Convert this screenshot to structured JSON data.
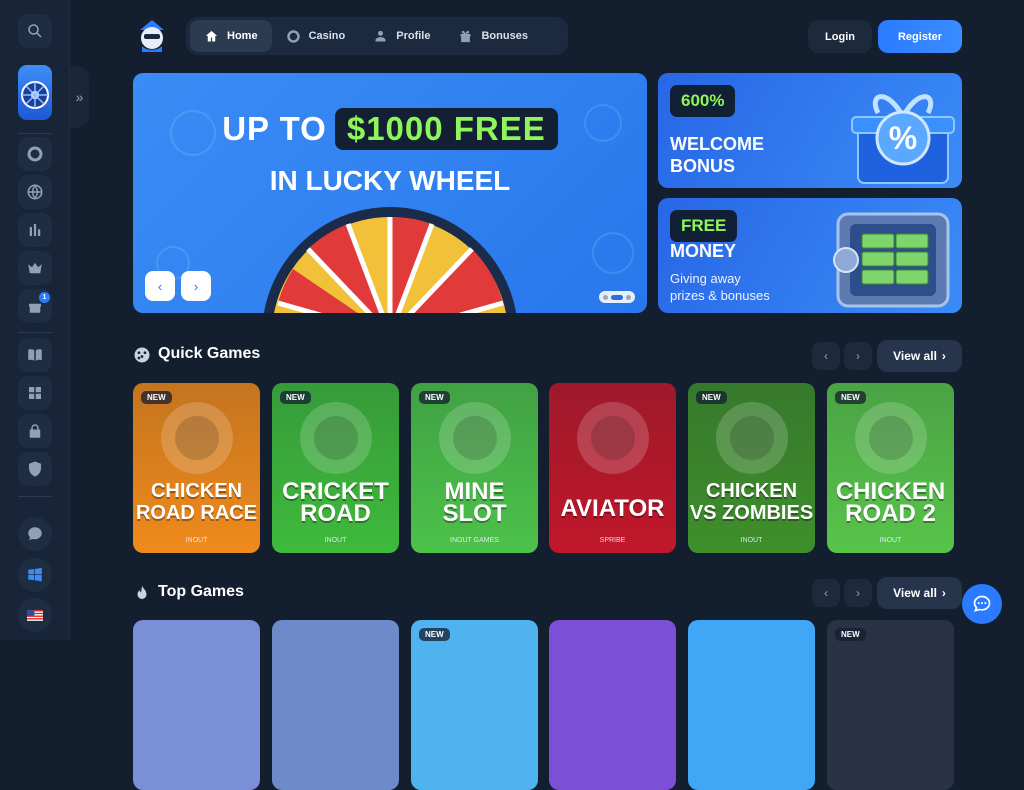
{
  "nav": {
    "items": [
      {
        "label": "Home",
        "icon": "home-icon",
        "active": true
      },
      {
        "label": "Casino",
        "icon": "chip-icon"
      },
      {
        "label": "Profile",
        "icon": "user-icon"
      },
      {
        "label": "Bonuses",
        "icon": "gift-icon"
      }
    ],
    "login_label": "Login",
    "register_label": "Register"
  },
  "sidebar": {
    "badge_count": "1",
    "icons": [
      "search-icon",
      "lucky-wheel-icon",
      "chip-icon",
      "globe-icon",
      "chart-icon",
      "crown-icon",
      "gift-icon",
      "book-icon",
      "puzzle-icon",
      "lock-icon",
      "shield-icon",
      "chat-icon",
      "windows-icon",
      "flag-us-icon"
    ]
  },
  "hero": {
    "line1_prefix": "UP TO",
    "line1_highlight": "$1000 FREE",
    "line2": "IN LUCKY WHEEL",
    "prev_label": "‹",
    "next_label": "›"
  },
  "promos": [
    {
      "pill": "600%",
      "title_line1": "WELCOME",
      "title_line2": "BONUS"
    },
    {
      "pill": "FREE",
      "title_line1": "MONEY",
      "sub_line1": "Giving away",
      "sub_line2": "prizes & bonuses"
    }
  ],
  "quick_games": {
    "title": "Quick Games",
    "view_all": "View all",
    "games": [
      {
        "badge": "NEW",
        "line1": "CHICKEN",
        "line2": "ROAD RACE",
        "provider": "INOUT",
        "color": "#f08a1c"
      },
      {
        "badge": "NEW",
        "line1": "CRICKET",
        "line2": "ROAD",
        "provider": "INOUT",
        "color": "#3fba3c"
      },
      {
        "badge": "NEW",
        "line1": "MINE",
        "line2": "SLOT",
        "provider": "INOUT GAMES",
        "color": "#4cc24a"
      },
      {
        "badge": "",
        "line1": "",
        "line2": "AVIATOR",
        "provider": "SPRIBE",
        "color": "#c0182a"
      },
      {
        "badge": "NEW",
        "line1": "CHICKEN",
        "line2": "VS ZOMBIES",
        "provider": "INOUT",
        "color": "#3f8f2c"
      },
      {
        "badge": "NEW",
        "line1": "CHICKEN",
        "line2": "ROAD 2",
        "provider": "INOUT",
        "color": "#58c44a"
      }
    ]
  },
  "top_games": {
    "title": "Top Games",
    "view_all": "View all",
    "badges": [
      "",
      "",
      "NEW",
      "",
      "",
      "NEW"
    ]
  },
  "colors": {
    "accent": "#2a7bff",
    "highlight_green": "#8ef65a",
    "background": "#131e2e"
  }
}
